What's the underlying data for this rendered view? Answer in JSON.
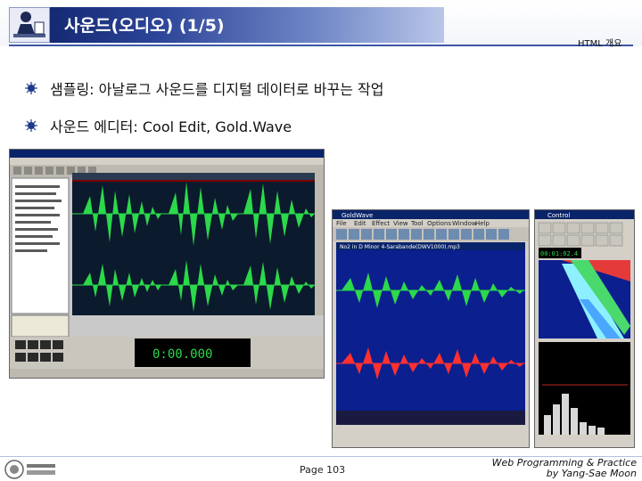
{
  "header": {
    "title": "사운드(오디오) (1/5)",
    "section_label": "HTML 개요"
  },
  "bullets": [
    {
      "text": "샘플링: 아날로그 사운드를 디지털 데이터로 바꾸는 작업"
    },
    {
      "text": "사운드 에디터: Cool Edit, Gold.Wave"
    }
  ],
  "cool_edit": {
    "time_display": "0:00.000"
  },
  "goldwave": {
    "window_title": "GoldWave",
    "menu_items": [
      "File",
      "Edit",
      "Effect",
      "View",
      "Tool",
      "Options",
      "Window",
      "Help"
    ],
    "file_title": "No2 in D Minor 4-Sarabande(DWV1000).mp3"
  },
  "control": {
    "window_title": "Control",
    "time_display": "00:01:02.4"
  },
  "footer": {
    "page": "Page 103",
    "course_line1": "Web Programming & Practice",
    "course_line2": "by Yang-Sae Moon"
  },
  "colors": {
    "title_bar": "#0b1f66",
    "wave_green": "#2bd94a",
    "wave_red": "#ff3030",
    "goldwave_bg": "#0b1f8f"
  }
}
